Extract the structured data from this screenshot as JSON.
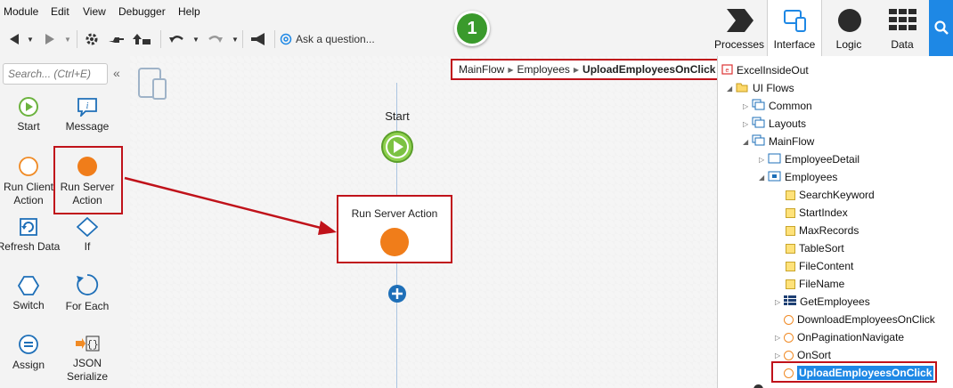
{
  "menubar": {
    "items": [
      "Module",
      "Edit",
      "View",
      "Debugger",
      "Help"
    ]
  },
  "toolbar": {
    "ask_label": "Ask a question..."
  },
  "step_badge": "1",
  "main_tabs": [
    {
      "label": "Processes",
      "icon": "processes-icon"
    },
    {
      "label": "Interface",
      "icon": "interface-icon",
      "active": true
    },
    {
      "label": "Logic",
      "icon": "logic-icon"
    },
    {
      "label": "Data",
      "icon": "data-icon"
    }
  ],
  "toolbox": {
    "search_placeholder": "Search... (Ctrl+E)",
    "tools": [
      {
        "label": "Start",
        "icon": "start-icon"
      },
      {
        "label": "Message",
        "icon": "message-icon"
      },
      {
        "label": "Run Client Action",
        "icon": "run-client-action-icon"
      },
      {
        "label": "Run Server Action",
        "icon": "run-server-action-icon"
      },
      {
        "label": "Refresh Data",
        "icon": "refresh-data-icon"
      },
      {
        "label": "If",
        "icon": "if-icon"
      },
      {
        "label": "Switch",
        "icon": "switch-icon"
      },
      {
        "label": "For Each",
        "icon": "for-each-icon"
      },
      {
        "label": "Assign",
        "icon": "assign-icon"
      },
      {
        "label": "JSON Serialize",
        "icon": "json-serialize-icon"
      }
    ]
  },
  "canvas": {
    "breadcrumb": [
      "MainFlow",
      "Employees",
      "UploadEmployeesOnClick"
    ],
    "start_label": "Start",
    "server_action_label": "Run Server Action"
  },
  "tree": {
    "root": "ExcelInsideOut",
    "ui_flows": "UI Flows",
    "common": "Common",
    "layouts": "Layouts",
    "mainflow": "MainFlow",
    "employee_detail": "EmployeeDetail",
    "employees": "Employees",
    "variables": [
      "SearchKeyword",
      "StartIndex",
      "MaxRecords",
      "TableSort",
      "FileContent",
      "FileName"
    ],
    "get_employees": "GetEmployees",
    "actions": [
      "DownloadEmployeesOnClick",
      "OnPaginationNavigate",
      "OnSort",
      "UploadEmployeesOnClick"
    ]
  },
  "colors": {
    "accent": "#1e88e5",
    "highlight": "#c0121a",
    "server_action": "#f07d1a",
    "start": "#7cc242"
  }
}
